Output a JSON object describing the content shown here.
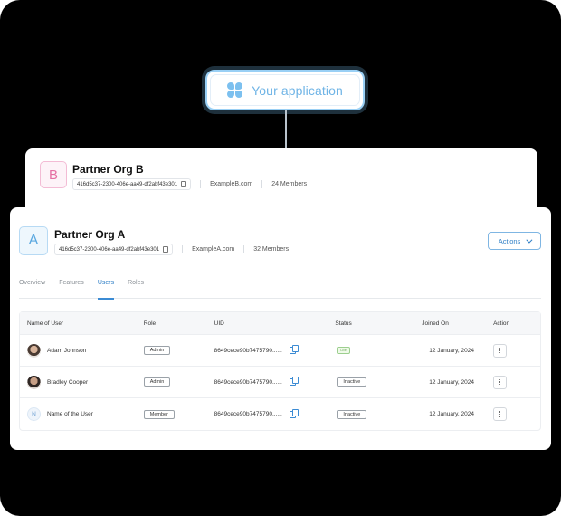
{
  "app_pill": {
    "label": "Your application",
    "icon": "clover-icon"
  },
  "org_b": {
    "initial": "B",
    "name": "Partner Org B",
    "id": "416d5c37-2300-406e-aa49-df2abf43e301",
    "domain": "ExampleB.com",
    "members": "24 Members"
  },
  "org_a": {
    "initial": "A",
    "name": "Partner Org A",
    "id": "416d5c37-2300-406e-aa49-df2abf43e301",
    "domain": "ExampleA.com",
    "members": "32 Members",
    "actions_label": "Actions"
  },
  "tabs": [
    {
      "label": "Overview",
      "active": false
    },
    {
      "label": "Features",
      "active": false
    },
    {
      "label": "Users",
      "active": true
    },
    {
      "label": "Roles",
      "active": false
    }
  ],
  "table": {
    "headers": [
      "Name of User",
      "Role",
      "UID",
      "Status",
      "Joined On",
      "Action"
    ],
    "rows": [
      {
        "avatar": "photo",
        "name": "Adam Johnson",
        "role": "Admin",
        "uid": "8649cece90b7475790......",
        "status": "Live",
        "joined": "12 January, 2024"
      },
      {
        "avatar": "photo",
        "name": "Bradley Cooper",
        "role": "Admin",
        "uid": "8649cece90b7475790......",
        "status": "Inactive",
        "joined": "12 January, 2024"
      },
      {
        "avatar": "N",
        "name": "Name of the User",
        "role": "Member",
        "uid": "8649cece90b7475790......",
        "status": "Inactive",
        "joined": "12 January, 2024"
      }
    ]
  },
  "colors": {
    "accent": "#3b8bd4",
    "pill_border": "#9ad0f5",
    "live_green": "#6aa85a"
  }
}
